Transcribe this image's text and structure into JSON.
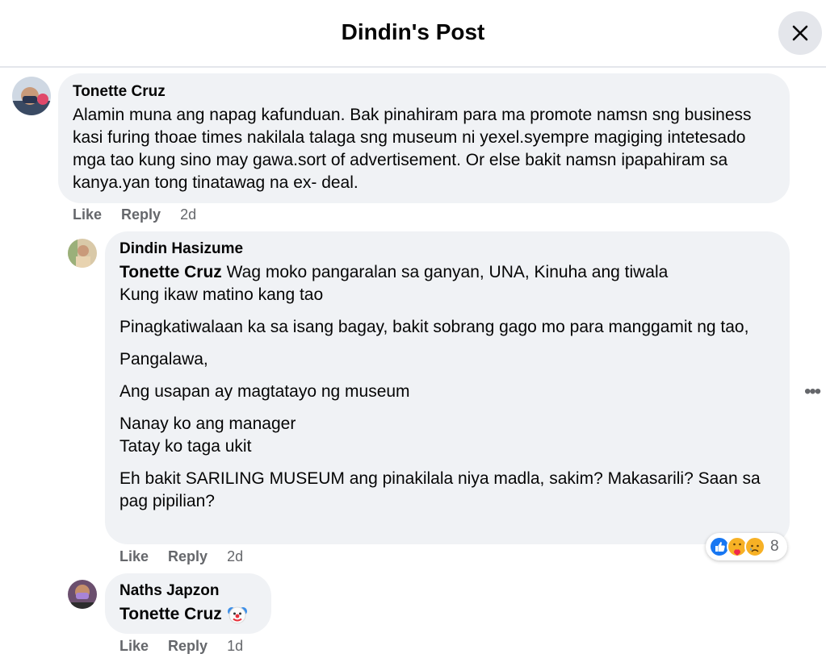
{
  "header": {
    "title": "Dindin's Post"
  },
  "comments": [
    {
      "author": "Tonette Cruz",
      "paragraphs": [
        "Alamin muna ang napag kafunduan. Bak pinahiram para ma promote namsn sng business kasi furing thoae times nakilala talaga sng museum ni yexel.syempre magiging intetesado mga tao kung sino may gawa.sort of advertisement. Or else bakit namsn ipapahiram sa kanya.yan tong tinatawag na ex- deal."
      ],
      "like": "Like",
      "reply": "Reply",
      "time": "2d"
    },
    {
      "author": "Dindin Hasizume",
      "mention": "Tonette Cruz",
      "first_line_rest": " Wag moko pangaralan sa ganyan, UNA, Kinuha ang tiwala",
      "paragraphs": [
        "Kung ikaw matino kang tao",
        "Pinagkatiwalaan ka sa isang bagay, bakit sobrang gago mo para manggamit ng tao,",
        "Pangalawa,",
        "Ang usapan ay magtatayo ng museum",
        "Nanay ko ang manager",
        "Tatay ko taga ukit",
        "Eh bakit SARILING MUSEUM ang pinakilala niya madla, sakim? Makasarili? Saan sa pag pipilian?"
      ],
      "like": "Like",
      "reply": "Reply",
      "time": "2d",
      "reaction_count": "8",
      "reaction_icons": [
        "like-icon",
        "care-icon",
        "sad-icon"
      ]
    },
    {
      "author": "Naths Japzon",
      "mention": "Tonette Cruz",
      "emoji_icon": "clown-face-icon",
      "like": "Like",
      "reply": "Reply",
      "time": "1d"
    }
  ],
  "more_options_icon": "more-dots-icon",
  "colors": {
    "bubble": "#f0f2f5",
    "meta": "#65676b",
    "like_blue": "#1877f2"
  }
}
